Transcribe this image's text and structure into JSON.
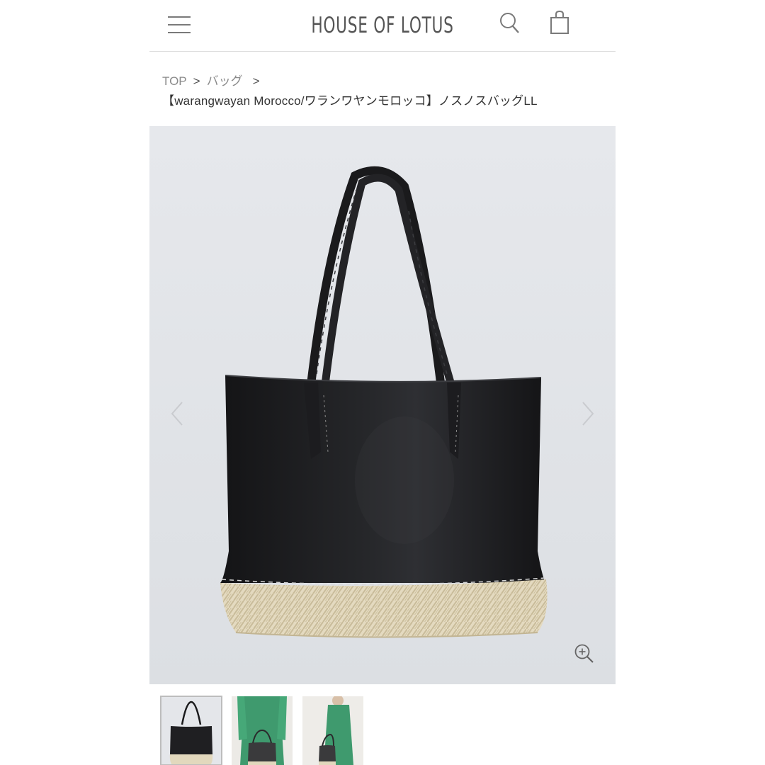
{
  "header": {
    "logo": "HOUSE OF LOTUS",
    "icons": [
      "menu-icon",
      "search-icon",
      "shopping-bag-icon"
    ]
  },
  "breadcrumb": {
    "items": [
      "TOP",
      "バッグ"
    ],
    "separator": ">"
  },
  "product": {
    "title": "【warangwayan Morocco/ワランワヤンモロッコ】ノスノスバッグLL"
  },
  "gallery": {
    "main_image": "black-leather-tote-with-woven-straw-base",
    "thumbnails": [
      {
        "name": "black-leather-tote-front",
        "selected": true
      },
      {
        "name": "model-green-dress-holding-bag",
        "selected": false
      },
      {
        "name": "model-green-dress-bag-side",
        "selected": false
      }
    ],
    "icons": [
      "chevron-left-icon",
      "chevron-right-icon",
      "zoom-in-icon"
    ]
  },
  "colors": {
    "text": "#333333",
    "muted": "#8a8a8a",
    "image_bg": "#e4e6ea",
    "leather": "#1c1c1e",
    "straw": "#e2d8bd"
  }
}
